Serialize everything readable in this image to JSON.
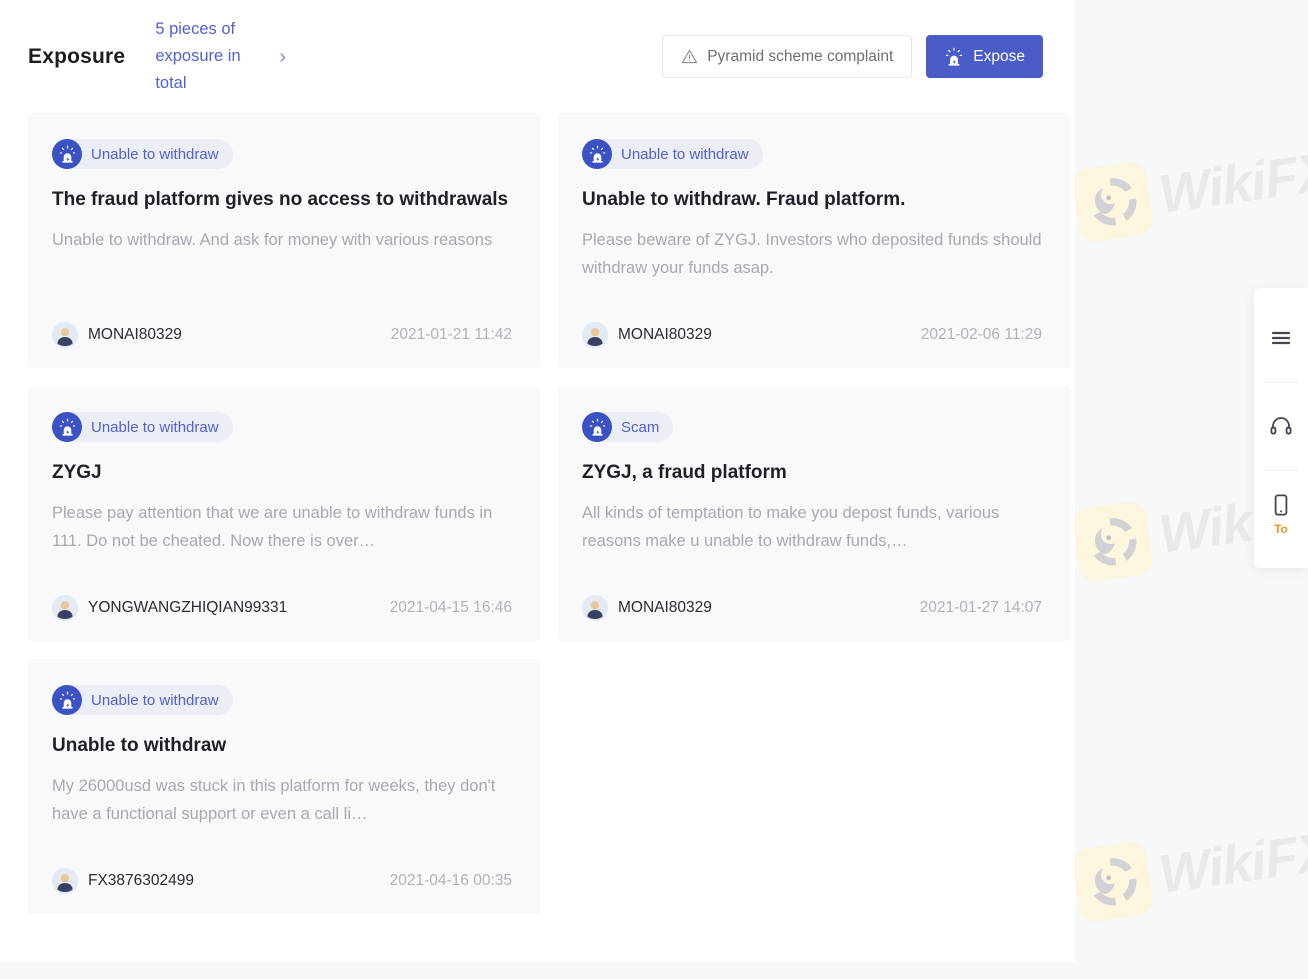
{
  "header": {
    "title": "Exposure",
    "summary_link": "5 pieces of exposure in total",
    "chevron_icon": "chevron-right-icon",
    "complaint_button": {
      "label": "Pyramid scheme complaint",
      "icon": "warning-triangle-icon"
    },
    "expose_button": {
      "label": "Expose",
      "icon": "siren-icon",
      "color": "#4a5cc8"
    }
  },
  "colors": {
    "accent": "#4a5cc8",
    "badge_text": "#4f62d0",
    "badge_bg": "#eceef6",
    "card_bg": "#f8f9fb",
    "page_bg": "#f7f8fa",
    "panel_bg": "#ffffff",
    "muted_text": "#a7a9b2",
    "top_label": "#e8972b"
  },
  "cards": [
    {
      "badge": "Unable to withdraw",
      "badge_icon": "siren-icon",
      "title": "The fraud platform gives no access to withdrawals",
      "desc": "Unable to withdraw. And ask for money with various reasons",
      "user": "MONAI80329",
      "avatar_icon": "user-avatar-icon",
      "date": "2021-01-21 11:42"
    },
    {
      "badge": "Unable to withdraw",
      "badge_icon": "siren-icon",
      "title": "Unable to withdraw. Fraud platform.",
      "desc": "Please beware of ZYGJ. Investors who deposited funds should withdraw your funds asap.",
      "user": "MONAI80329",
      "avatar_icon": "user-avatar-icon",
      "date": "2021-02-06 11:29"
    },
    {
      "badge": "Unable to withdraw",
      "badge_icon": "siren-icon",
      "title": "ZYGJ",
      "desc": "Please pay attention that we are unable to withdraw funds in 111. Do not be cheated. Now there is over…",
      "user": "YONGWANGZHIQIAN99331",
      "avatar_icon": "user-avatar-icon",
      "date": "2021-04-15 16:46"
    },
    {
      "badge": "Scam",
      "badge_icon": "siren-icon",
      "title": "ZYGJ, a fraud platform",
      "desc": "All kinds of temptation to make you depost funds, various reasons make u unable to withdraw funds,…",
      "user": "MONAI80329",
      "avatar_icon": "user-avatar-icon",
      "date": "2021-01-27 14:07"
    },
    {
      "badge": "Unable to withdraw",
      "badge_icon": "siren-icon",
      "title": "Unable to withdraw",
      "desc": "My 26000usd was stuck in this platform for weeks, they don't have a functional support or even a call li…",
      "user": "FX3876302499",
      "avatar_icon": "user-avatar-icon",
      "date": "2021-04-16 00:35"
    }
  ],
  "rail": {
    "items": [
      {
        "icon": "list-menu-icon",
        "label": ""
      },
      {
        "icon": "headset-icon",
        "label": ""
      },
      {
        "icon": "mobile-app-icon",
        "label": ""
      }
    ],
    "top_label": "To"
  },
  "watermark": {
    "text": "WikiFX",
    "logo_icon": "wikifx-eagle-icon"
  }
}
